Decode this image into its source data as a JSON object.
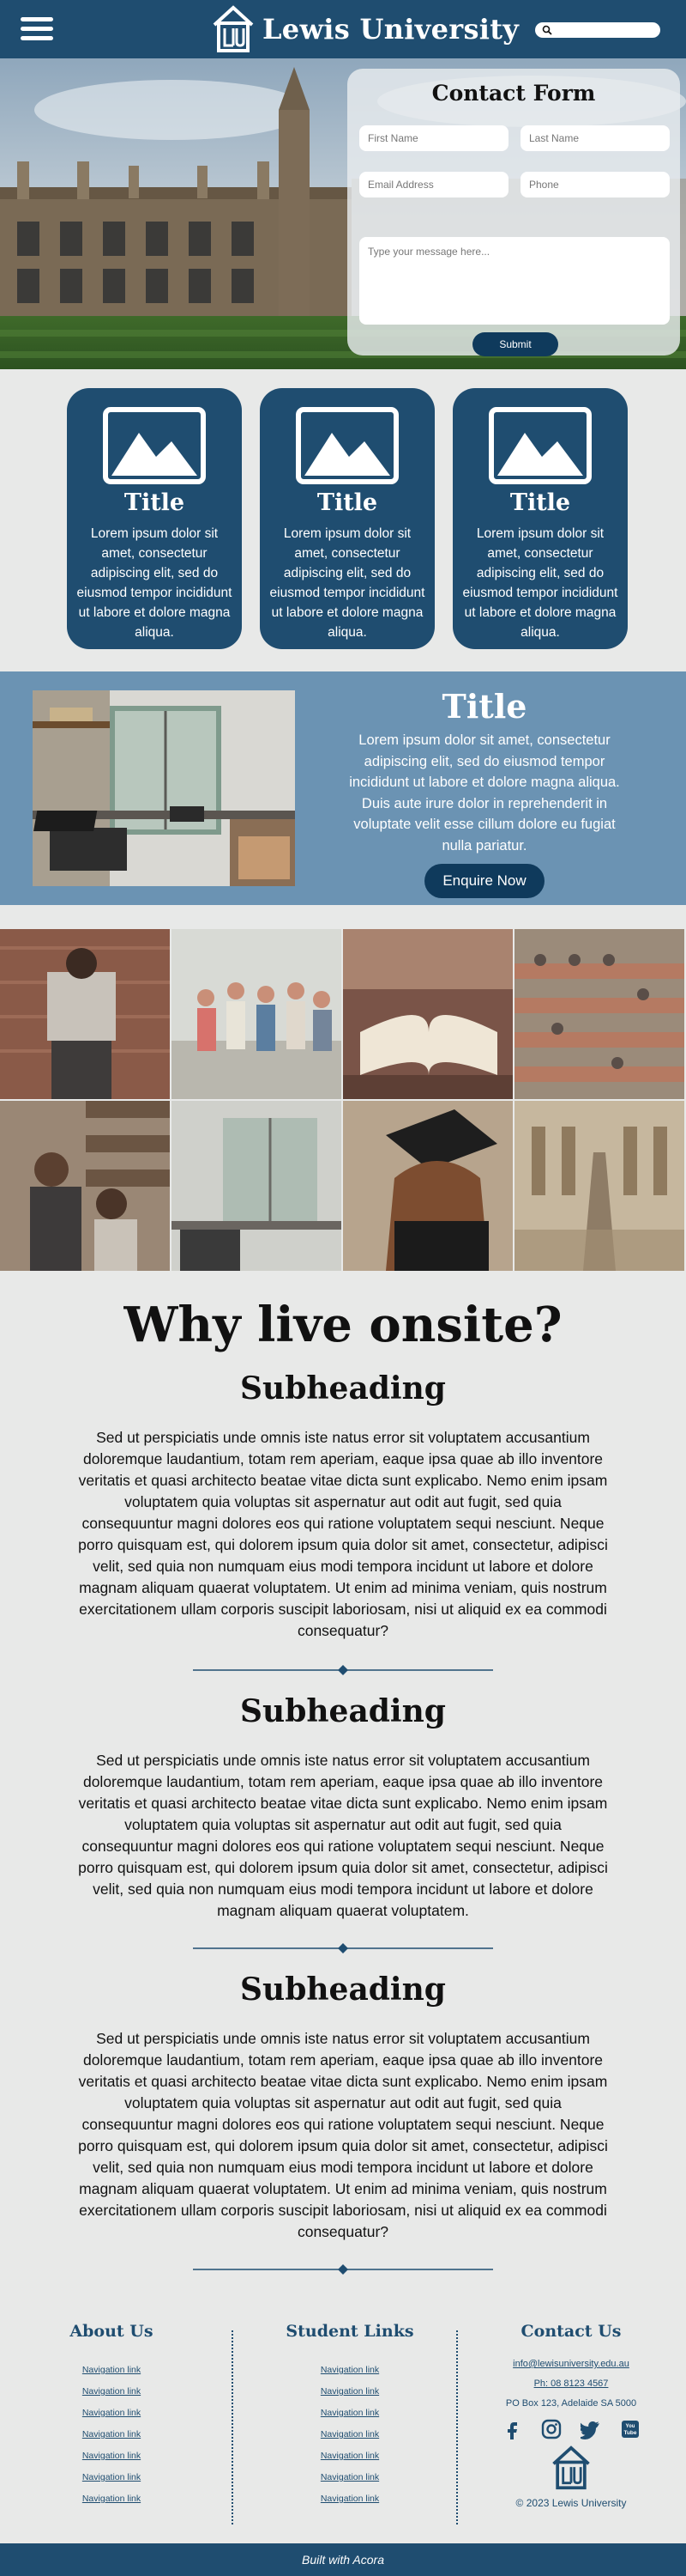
{
  "header": {
    "logo_text": "Lewis University",
    "search_placeholder": "",
    "brand_color": "#1f4d70"
  },
  "contact_form": {
    "title": "Contact Form",
    "first_name_placeholder": "First Name",
    "last_name_placeholder": "Last Name",
    "email_placeholder": "Email Address",
    "phone_placeholder": "Phone",
    "message_placeholder": "Type your message here...",
    "submit_label": "Submit"
  },
  "cards": [
    {
      "title": "Title",
      "text": "Lorem ipsum dolor sit amet, consectetur adipiscing elit, sed do eiusmod tempor incididunt ut labore et dolore magna aliqua."
    },
    {
      "title": "Title",
      "text": "Lorem ipsum dolor sit amet, consectetur adipiscing elit, sed do eiusmod tempor incididunt ut labore et dolore magna aliqua."
    },
    {
      "title": "Title",
      "text": "Lorem ipsum dolor sit amet, consectetur adipiscing elit, sed do eiusmod tempor incididunt ut labore et dolore magna aliqua."
    }
  ],
  "feature": {
    "title": "Title",
    "text": "Lorem ipsum dolor sit amet, consectetur adipiscing elit, sed do eiusmod tempor incididunt ut labore et dolore magna aliqua. Duis aute irure dolor in reprehenderit in voluptate velit esse cillum dolore eu fugiat nulla pariatur.",
    "button_label": "Enquire Now"
  },
  "why": {
    "heading": "Why live onsite?",
    "sections": [
      {
        "subheading": "Subheading",
        "text": "Sed ut perspiciatis unde omnis iste natus error sit voluptatem accusantium doloremque laudantium, totam rem aperiam, eaque ipsa quae ab illo inventore veritatis et quasi architecto beatae vitae dicta sunt explicabo. Nemo enim ipsam voluptatem quia voluptas sit aspernatur aut odit aut fugit, sed quia consequuntur magni dolores eos qui ratione voluptatem sequi nesciunt. Neque porro quisquam est, qui dolorem ipsum quia dolor sit amet, consectetur, adipisci velit, sed quia non numquam eius modi tempora incidunt ut labore et dolore magnam aliquam quaerat voluptatem. Ut enim ad minima veniam, quis nostrum exercitationem ullam corporis suscipit laboriosam, nisi ut aliquid ex ea commodi consequatur?"
      },
      {
        "subheading": "Subheading",
        "text": "Sed ut perspiciatis unde omnis iste natus error sit voluptatem accusantium doloremque laudantium, totam rem aperiam, eaque ipsa quae ab illo inventore veritatis et quasi architecto beatae vitae dicta sunt explicabo. Nemo enim ipsam voluptatem quia voluptas sit aspernatur aut odit aut fugit, sed quia consequuntur magni dolores eos qui ratione voluptatem sequi nesciunt. Neque porro quisquam est, qui dolorem ipsum quia dolor sit amet, consectetur, adipisci velit, sed quia non numquam eius modi tempora incidunt ut labore et dolore magnam aliquam quaerat voluptatem."
      },
      {
        "subheading": "Subheading",
        "text": "Sed ut perspiciatis unde omnis iste natus error sit voluptatem accusantium doloremque laudantium, totam rem aperiam, eaque ipsa quae ab illo inventore veritatis et quasi architecto beatae vitae dicta sunt explicabo. Nemo enim ipsam voluptatem quia voluptas sit aspernatur aut odit aut fugit, sed quia consequuntur magni dolores eos qui ratione voluptatem sequi nesciunt. Neque porro quisquam est, qui dolorem ipsum quia dolor sit amet, consectetur, adipisci velit, sed quia non numquam eius modi tempora incidunt ut labore et dolore magnam aliquam quaerat voluptatem. Ut enim ad minima veniam, quis nostrum exercitationem ullam corporis suscipit laboriosam, nisi ut aliquid ex ea commodi consequatur?"
      }
    ]
  },
  "footer": {
    "about_heading": "About Us",
    "about_links": [
      "Navigation link",
      "Navigation link",
      "Navigation link",
      "Navigation link",
      "Navigation link",
      "Navigation link",
      "Navigation link"
    ],
    "student_heading": "Student Links",
    "student_links": [
      "Navigation link",
      "Navigation link",
      "Navigation link",
      "Navigation link",
      "Navigation link",
      "Navigation link",
      "Navigation link"
    ],
    "contact_heading": "Contact Us",
    "email": "info@lewisuniversity.edu.au",
    "phone": "Ph: 08 8123 4567",
    "address": "PO Box 123, Adelaide SA 5000",
    "social_icons": [
      "facebook-icon",
      "instagram-icon",
      "twitter-icon",
      "youtube-icon"
    ],
    "copyright": "© 2023 Lewis University",
    "built_with": "Built with Acora"
  }
}
